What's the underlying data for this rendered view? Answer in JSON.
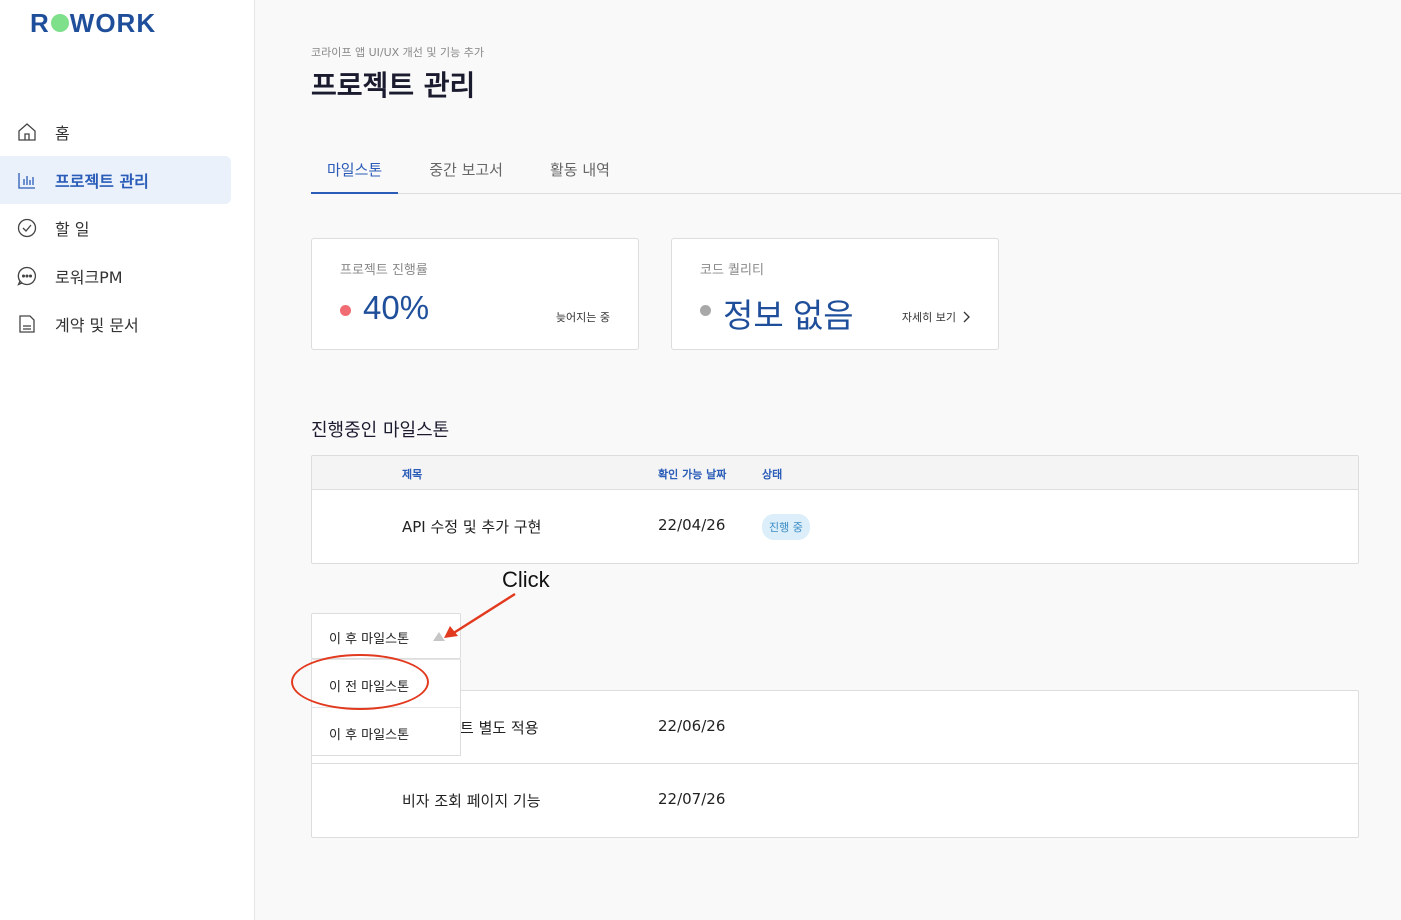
{
  "logo": {
    "left": "R",
    "right": "WORK"
  },
  "sidebar": {
    "items": [
      {
        "label": "홈",
        "icon": "home-icon"
      },
      {
        "label": "프로젝트 관리",
        "icon": "bar-chart-icon",
        "active": true
      },
      {
        "label": "할 일",
        "icon": "check-circle-icon"
      },
      {
        "label": "로워크PM",
        "icon": "chat-icon"
      },
      {
        "label": "계약 및 문서",
        "icon": "document-icon"
      }
    ]
  },
  "header": {
    "breadcrumb": "코라이프 앱 UI/UX 개선 및 기능 추가",
    "title": "프로젝트 관리"
  },
  "tabs": [
    {
      "label": "마일스톤",
      "active": true
    },
    {
      "label": "중간 보고서"
    },
    {
      "label": "활동 내역"
    }
  ],
  "cards": {
    "progress": {
      "title": "프로젝트 진행률",
      "value": "40%",
      "note": "늦어지는 중",
      "dot_color": "#f06b72"
    },
    "quality": {
      "title": "코드 퀄리티",
      "value": "정보 없음",
      "note": "자세히 보기",
      "dot_color": "#a8a8a8"
    }
  },
  "current_section": {
    "title": "진행중인 마일스톤",
    "headers": {
      "title": "제목",
      "date": "확인 가능 날짜",
      "status": "상태"
    },
    "rows": [
      {
        "title": "API 수정 및 추가 구현",
        "date": "22/04/26",
        "status": "진행 중"
      }
    ]
  },
  "dropdown": {
    "selected": "이 후 마일스톤",
    "options": [
      "이 전 마일스톤",
      "이 후 마일스톤"
    ]
  },
  "upcoming": {
    "rows": [
      {
        "title": "트 별도 적용",
        "date": "22/06/26"
      },
      {
        "title": "비자 조회 페이지 기능",
        "date": "22/07/26"
      }
    ]
  },
  "annotation": {
    "text": "Click",
    "color": "#e23a1f"
  }
}
